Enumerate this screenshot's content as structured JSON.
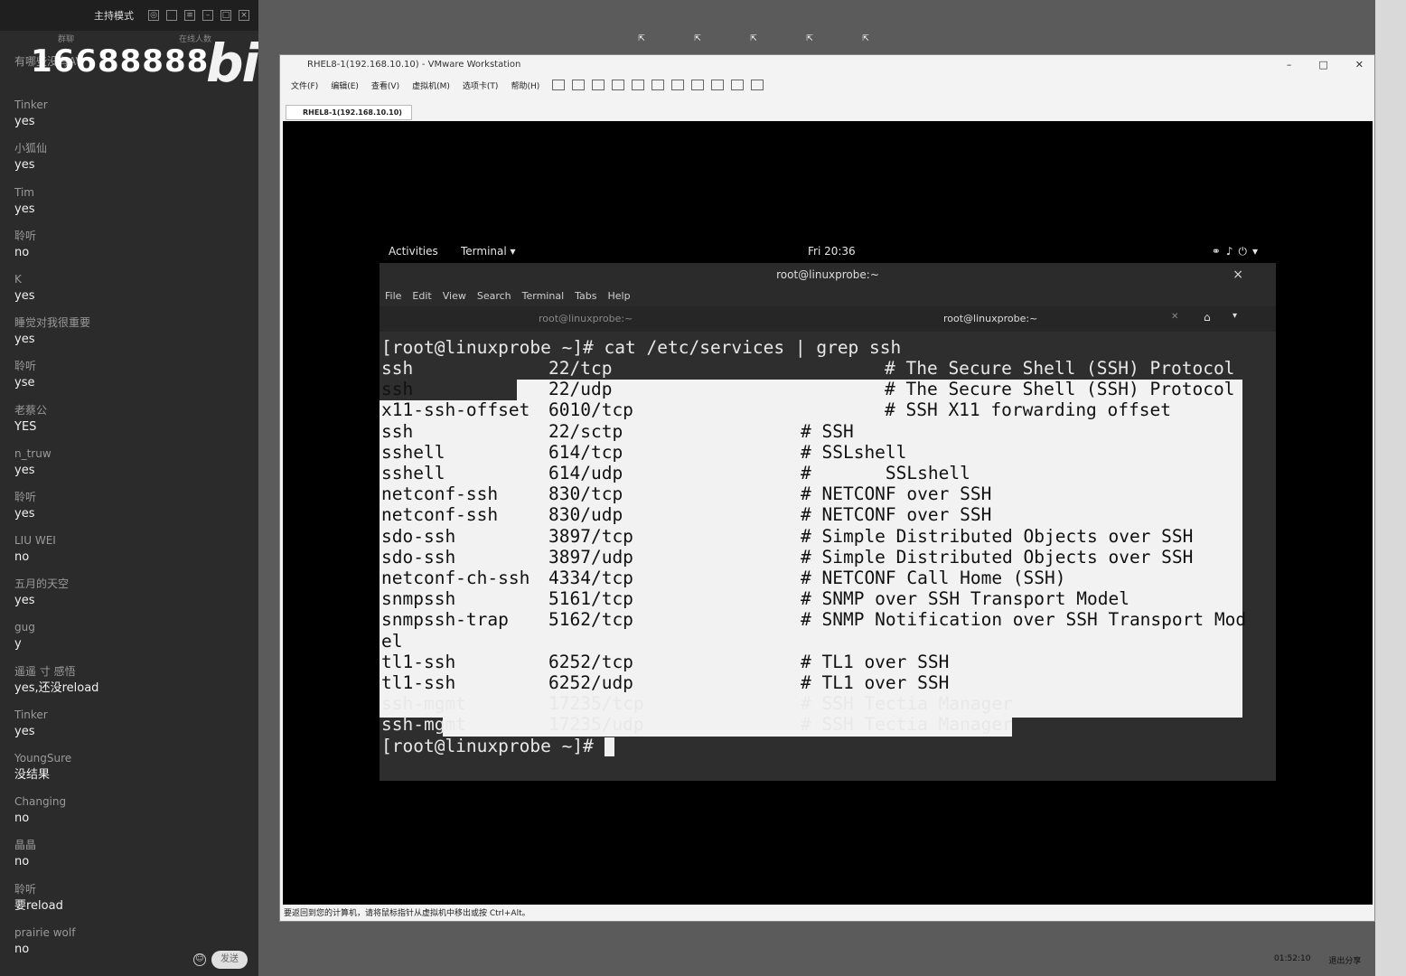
{
  "chat": {
    "mode": "主持模式",
    "tabs": [
      "群聊",
      "在线人数"
    ],
    "room_id": "16688888",
    "watermark": "bili",
    "messages": [
      {
        "user": "有哪些没有AV",
        "text": ""
      },
      {
        "user": "Tinker",
        "text": "yes"
      },
      {
        "user": "小狐仙",
        "text": "yes"
      },
      {
        "user": "Tim",
        "text": "yes"
      },
      {
        "user": "聆听",
        "text": "no"
      },
      {
        "user": "K",
        "text": "yes"
      },
      {
        "user": "睡觉对我很重要",
        "text": "yes"
      },
      {
        "user": "聆听",
        "text": "yse"
      },
      {
        "user": "老蔡公",
        "text": "YES"
      },
      {
        "user": "n_truw",
        "text": "yes"
      },
      {
        "user": "聆听",
        "text": "yes"
      },
      {
        "user": "LIU WEI",
        "text": "no"
      },
      {
        "user": "五月的天空",
        "text": "yes"
      },
      {
        "user": "gug",
        "text": "y"
      },
      {
        "user": "遥遥 寸 感悟",
        "text": "yes,还没reload"
      },
      {
        "user": "Tinker",
        "text": "yes"
      },
      {
        "user": "YoungSure",
        "text": "没结果"
      },
      {
        "user": "Changing",
        "text": "no"
      },
      {
        "user": "晶晶",
        "text": "no"
      },
      {
        "user": "聆听",
        "text": "要reload"
      },
      {
        "user": "prairie wolf",
        "text": "no"
      }
    ],
    "send_label": "发送"
  },
  "vmware": {
    "title": "RHEL8-1(192.168.10.10) - VMware Workstation",
    "menu": [
      "文件(F)",
      "编辑(E)",
      "查看(V)",
      "虚拟机(M)",
      "选项卡(T)",
      "帮助(H)"
    ],
    "tab_label": "RHEL8-1(192.168.10.10)",
    "status": "要返回到您的计算机，请将鼠标指针从虚拟机中移出或按 Ctrl+Alt。"
  },
  "gnome": {
    "activities": "Activities",
    "app_menu": "Terminal ▾",
    "clock": "Fri 20:36"
  },
  "terminal": {
    "window_title": "root@linuxprobe:~",
    "menu": [
      "File",
      "Edit",
      "View",
      "Search",
      "Terminal",
      "Tabs",
      "Help"
    ],
    "tabs": [
      "root@linuxprobe:~",
      "root@linuxprobe:~"
    ],
    "command_line": "[root@linuxprobe ~]# cat /etc/services | grep ssh",
    "prompt": "[root@linuxprobe ~]# ",
    "rows": [
      {
        "name": "ssh",
        "port": "22/tcp",
        "comment": "# The Secure Shell (SSH) Protocol"
      },
      {
        "name": "ssh",
        "port": "22/udp",
        "comment": "# The Secure Shell (SSH) Protocol"
      },
      {
        "name": "x11-ssh-offset",
        "port": "6010/tcp",
        "comment": "# SSH X11 forwarding offset"
      },
      {
        "name": "ssh",
        "port": "22/sctp",
        "comment": "# SSH"
      },
      {
        "name": "sshell",
        "port": "614/tcp",
        "comment": "# SSLshell"
      },
      {
        "name": "sshell",
        "port": "614/udp",
        "comment": "#       SSLshell"
      },
      {
        "name": "netconf-ssh",
        "port": "830/tcp",
        "comment": "# NETCONF over SSH"
      },
      {
        "name": "netconf-ssh",
        "port": "830/udp",
        "comment": "# NETCONF over SSH"
      },
      {
        "name": "sdo-ssh",
        "port": "3897/tcp",
        "comment": "# Simple Distributed Objects over SSH"
      },
      {
        "name": "sdo-ssh",
        "port": "3897/udp",
        "comment": "# Simple Distributed Objects over SSH"
      },
      {
        "name": "netconf-ch-ssh",
        "port": "4334/tcp",
        "comment": "# NETCONF Call Home (SSH)"
      },
      {
        "name": "snmpssh",
        "port": "5161/tcp",
        "comment": "# SNMP over SSH Transport Model"
      },
      {
        "name": "snmpssh-trap",
        "port": "5162/tcp",
        "comment": "# SNMP Notification over SSH Transport Mod"
      },
      {
        "name": "el",
        "port": "",
        "comment": ""
      },
      {
        "name": "tl1-ssh",
        "port": "6252/tcp",
        "comment": "# TL1 over SSH"
      },
      {
        "name": "tl1-ssh",
        "port": "6252/udp",
        "comment": "# TL1 over SSH"
      },
      {
        "name": "ssh-mgmt",
        "port": "17235/tcp",
        "comment": "# SSH Tectia Manager"
      },
      {
        "name": "ssh-mgmt",
        "port": "17235/udp",
        "comment": "# SSH Tectia Manager"
      }
    ]
  },
  "tray": {
    "time": "01:52:10",
    "exit_share": "退出分享"
  }
}
